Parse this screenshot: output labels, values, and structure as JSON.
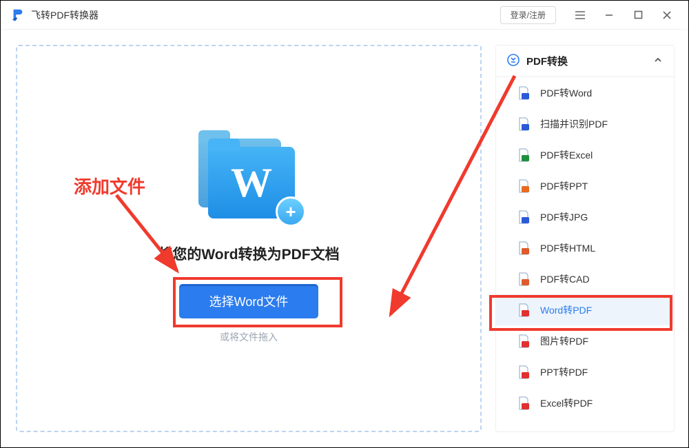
{
  "app": {
    "title": "飞转PDF转换器"
  },
  "titlebar": {
    "login_label": "登录/注册"
  },
  "drop": {
    "heading": "将您的Word转换为PDF文档",
    "select_button": "选择Word文件",
    "drag_hint": "或将文件拖入"
  },
  "sidebar": {
    "header": "PDF转换",
    "items": [
      {
        "label": "PDF转Word",
        "color": "#2b5ad8",
        "active": false
      },
      {
        "label": "扫描并识别PDF",
        "color": "#2b5ad8",
        "active": false
      },
      {
        "label": "PDF转Excel",
        "color": "#1f8f3e",
        "active": false
      },
      {
        "label": "PDF转PPT",
        "color": "#e86a1f",
        "active": false
      },
      {
        "label": "PDF转JPG",
        "color": "#2b5ad8",
        "active": false
      },
      {
        "label": "PDF转HTML",
        "color": "#e05a2b",
        "active": false
      },
      {
        "label": "PDF转CAD",
        "color": "#e05a2b",
        "active": false
      },
      {
        "label": "Word转PDF",
        "color": "#e22f2f",
        "active": true
      },
      {
        "label": "图片转PDF",
        "color": "#e22f2f",
        "active": false
      },
      {
        "label": "PPT转PDF",
        "color": "#e22f2f",
        "active": false
      },
      {
        "label": "Excel转PDF",
        "color": "#e22f2f",
        "active": false
      }
    ]
  },
  "annotation": {
    "add_file_label": "添加文件"
  },
  "colors": {
    "primary": "#2b7cee",
    "anno": "#f03a2d"
  }
}
